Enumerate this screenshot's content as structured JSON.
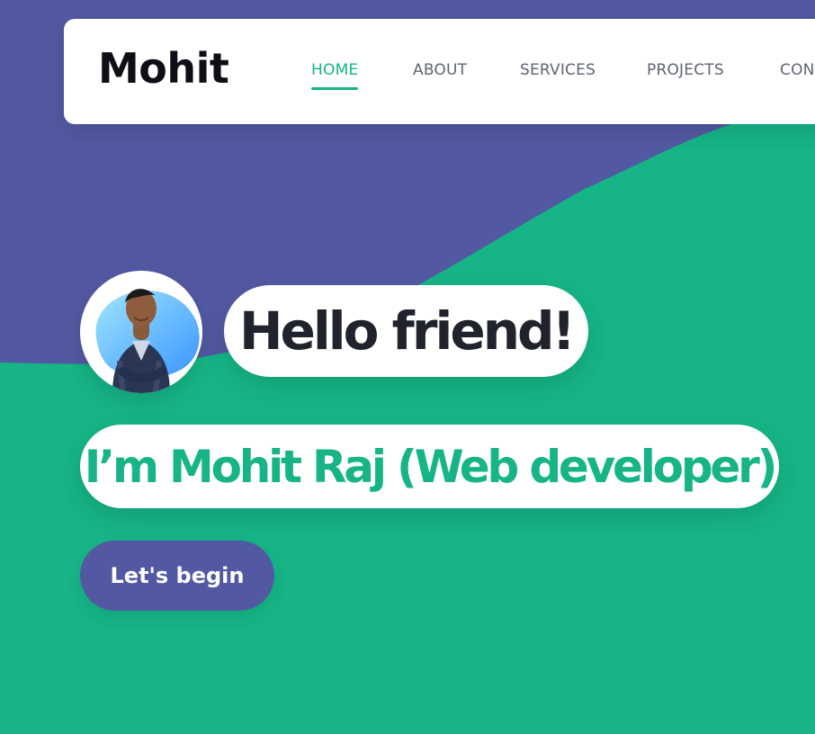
{
  "brand": {
    "logo_text": "Mohit"
  },
  "nav": {
    "items": [
      {
        "label": "HOME",
        "active": true
      },
      {
        "label": "ABOUT",
        "active": false
      },
      {
        "label": "SERVICES",
        "active": false
      },
      {
        "label": "PROJECTS",
        "active": false
      },
      {
        "label": "CON",
        "active": false
      }
    ]
  },
  "hero": {
    "greeting": "Hello friend!",
    "intro": "I’m Mohit Raj (Web developer)",
    "cta_label": "Let's begin"
  },
  "colors": {
    "accent_green": "#16b486",
    "purple": "#5259a2",
    "text_dark": "#20232b",
    "nav_text": "#5f6472",
    "white": "#ffffff"
  },
  "icons": {
    "avatar": "profile-photo"
  }
}
